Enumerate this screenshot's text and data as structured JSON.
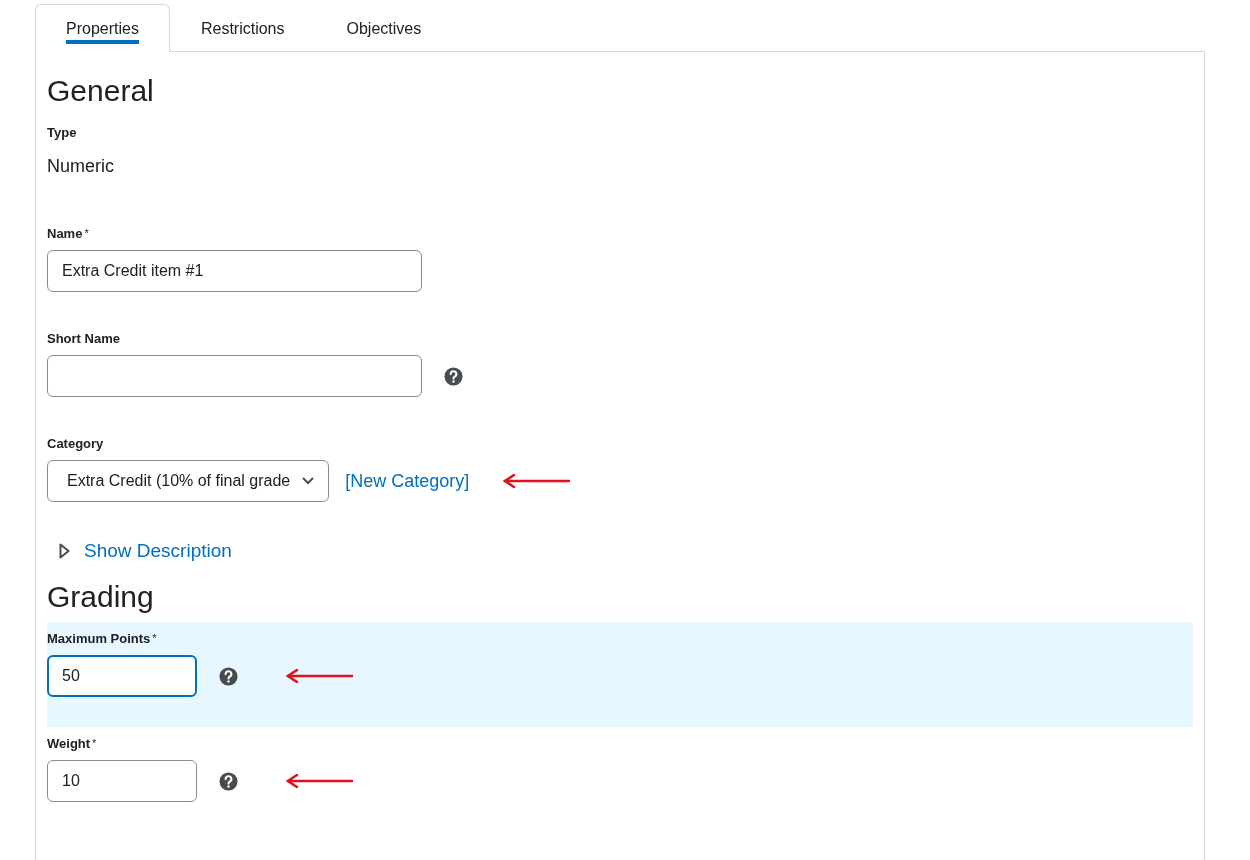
{
  "tabs": [
    {
      "label": "Properties",
      "selected": true
    },
    {
      "label": "Restrictions",
      "selected": false
    },
    {
      "label": "Objectives",
      "selected": false
    }
  ],
  "sections": [
    {
      "heading": "General",
      "items": [
        {
          "kind": "static",
          "label": "Type",
          "value": "Numeric"
        },
        {
          "kind": "text",
          "label": "Name",
          "required": true,
          "required_mark": "*",
          "value": "Extra Credit item #1",
          "help": false,
          "focused": false,
          "annotated": false
        },
        {
          "kind": "text",
          "label": "Short Name",
          "required": false,
          "value": "",
          "help": true,
          "focused": false,
          "annotated": false
        },
        {
          "kind": "select",
          "label": "Category",
          "required": false,
          "value": "Extra Credit (10% of final grade",
          "link": "[New Category]",
          "annotated": true
        },
        {
          "kind": "disclosure",
          "label": "Show Description",
          "expanded": false
        }
      ]
    },
    {
      "heading": "Grading",
      "items": [
        {
          "kind": "number",
          "label": "Maximum Points",
          "required": true,
          "required_mark": "*",
          "value": "50",
          "help": true,
          "focused": true,
          "annotated": true
        },
        {
          "kind": "number",
          "label": "Weight",
          "required": true,
          "required_mark": "*",
          "value": "10",
          "help": true,
          "focused": false,
          "annotated": true
        }
      ]
    }
  ]
}
